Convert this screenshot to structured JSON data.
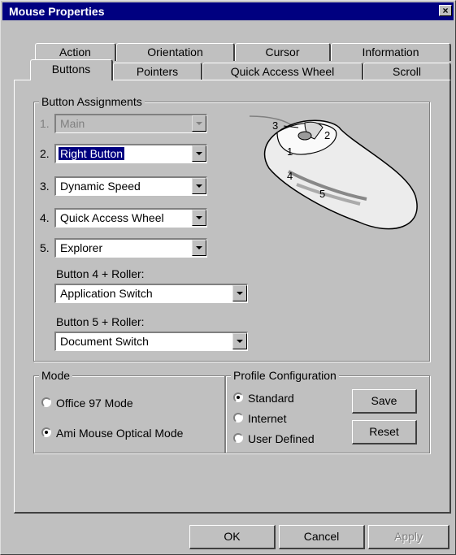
{
  "window": {
    "title": "Mouse Properties",
    "close_glyph": "×"
  },
  "tabs": {
    "row_back": [
      "Action",
      "Orientation",
      "Cursor",
      "Information"
    ],
    "row_front": [
      "Buttons",
      "Pointers",
      "Quick Access Wheel",
      "Scroll"
    ],
    "active": "Buttons"
  },
  "button_assignments": {
    "title": "Button  Assignments",
    "items": [
      {
        "number": "1.",
        "value": "Main",
        "disabled": true
      },
      {
        "number": "2.",
        "value": "Right Button",
        "selected": true
      },
      {
        "number": "3.",
        "value": "Dynamic Speed"
      },
      {
        "number": "4.",
        "value": "Quick Access Wheel"
      },
      {
        "number": "5.",
        "value": "Explorer"
      }
    ],
    "roller4_label": "Button 4 + Roller:",
    "roller4_value": "Application Switch",
    "roller5_label": "Button 5 + Roller:",
    "roller5_value": "Document Switch"
  },
  "mouse_diagram": {
    "labels": [
      "3",
      "2",
      "1",
      "4",
      "5"
    ]
  },
  "mode": {
    "title": "Mode",
    "options": [
      "Office 97 Mode",
      "Ami Mouse Optical Mode"
    ],
    "selected_index": 1
  },
  "profile": {
    "title": "Profile Configuration",
    "options": [
      "Standard",
      "Internet",
      "User Defined"
    ],
    "selected_index": 0,
    "save_label": "Save",
    "reset_label": "Reset"
  },
  "footer": {
    "ok_label": "OK",
    "cancel_label": "Cancel",
    "apply_label": "Apply"
  },
  "colors": {
    "face": "#c0c0c0",
    "title_bar": "#000080",
    "selection": "#000080"
  }
}
